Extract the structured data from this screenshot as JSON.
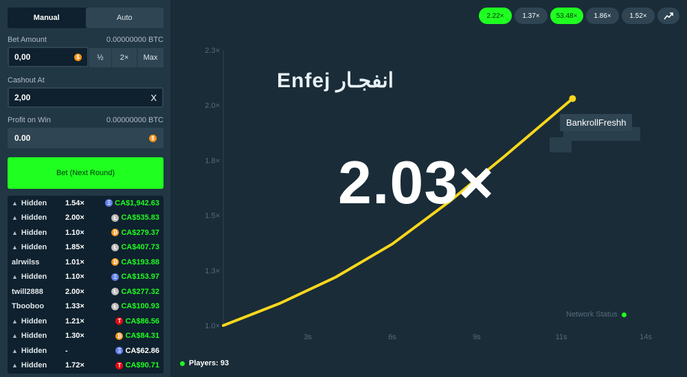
{
  "sidebar": {
    "tabs": [
      {
        "label": "Manual"
      },
      {
        "label": "Auto"
      }
    ],
    "bet_amount": {
      "label": "Bet Amount",
      "btc": "0.00000000 BTC",
      "value": "0,00",
      "half": "½",
      "double": "2×",
      "max": "Max"
    },
    "cashout": {
      "label": "Cashout At",
      "value": "2,00",
      "clear": "X"
    },
    "profit": {
      "label": "Profit on Win",
      "btc": "0.00000000 BTC",
      "value": "0.00"
    },
    "bet_button": "Bet (Next Round)",
    "players": [
      {
        "name": "Hidden",
        "hidden": true,
        "mult": "1.54×",
        "coin": "eth",
        "profit": "CA$1,942.63",
        "won": true
      },
      {
        "name": "Hidden",
        "hidden": true,
        "mult": "2.00×",
        "coin": "ltc",
        "profit": "CA$535.83",
        "won": true
      },
      {
        "name": "Hidden",
        "hidden": true,
        "mult": "1.10×",
        "coin": "btc",
        "profit": "CA$279.37",
        "won": true
      },
      {
        "name": "Hidden",
        "hidden": true,
        "mult": "1.85×",
        "coin": "ltc",
        "profit": "CA$407.73",
        "won": true
      },
      {
        "name": "alrwilss",
        "hidden": false,
        "mult": "1.01×",
        "coin": "btc",
        "profit": "CA$193.88",
        "won": true
      },
      {
        "name": "Hidden",
        "hidden": true,
        "mult": "1.10×",
        "coin": "eth",
        "profit": "CA$153.97",
        "won": true
      },
      {
        "name": "twill2888",
        "hidden": false,
        "mult": "2.00×",
        "coin": "ltc",
        "profit": "CA$277.32",
        "won": true
      },
      {
        "name": "Tbooboo",
        "hidden": false,
        "mult": "1.33×",
        "coin": "ltc",
        "profit": "CA$100.93",
        "won": true
      },
      {
        "name": "Hidden",
        "hidden": true,
        "mult": "1.21×",
        "coin": "trx",
        "profit": "CA$86.56",
        "won": true
      },
      {
        "name": "Hidden",
        "hidden": true,
        "mult": "1.30×",
        "coin": "btc",
        "profit": "CA$84.31",
        "won": true
      },
      {
        "name": "Hidden",
        "hidden": true,
        "mult": "-",
        "coin": "eth",
        "profit": "CA$62.86",
        "won": false
      },
      {
        "name": "Hidden",
        "hidden": true,
        "mult": "1.72×",
        "coin": "trx",
        "profit": "CA$90.71",
        "won": true
      }
    ]
  },
  "history": [
    {
      "label": "2.22×",
      "green": true
    },
    {
      "label": "1.37×",
      "green": false
    },
    {
      "label": "53.48×",
      "green": true
    },
    {
      "label": "1.86×",
      "green": false
    },
    {
      "label": "1.52×",
      "green": false
    }
  ],
  "icons": {
    "history_stats": "trend-icon",
    "hidden_user": "incognito-icon"
  },
  "colors": {
    "accent_green": "#1fff20",
    "curve": "#f9d71c",
    "background": "#1a2c38",
    "panel": "#213743"
  },
  "watermark": {
    "latin": "Enfej",
    "arabic": "انفجـار"
  },
  "game": {
    "multiplier": "2.03×",
    "tooltip_user": "BankrollFreshh",
    "network_status": "Network Status",
    "players_label": "Players: 93"
  },
  "chart_data": {
    "type": "line",
    "x_ticks": [
      "3s",
      "6s",
      "9s",
      "11s",
      "14s"
    ],
    "x_tick_values": [
      3,
      6,
      9,
      12,
      15
    ],
    "y_ticks": [
      "1.0×",
      "1.3×",
      "1.5×",
      "1.8×",
      "2.0×",
      "2.3×"
    ],
    "y_tick_values": [
      1.0,
      1.25,
      1.5,
      1.75,
      2.0,
      2.25
    ],
    "xlim": [
      0,
      15
    ],
    "ylim": [
      1.0,
      2.25
    ],
    "series": [
      {
        "x": [
          0,
          2,
          4,
          6,
          8,
          10,
          12.4
        ],
        "y": [
          1.0,
          1.1,
          1.22,
          1.37,
          1.56,
          1.77,
          2.03
        ]
      }
    ],
    "grid": false
  }
}
